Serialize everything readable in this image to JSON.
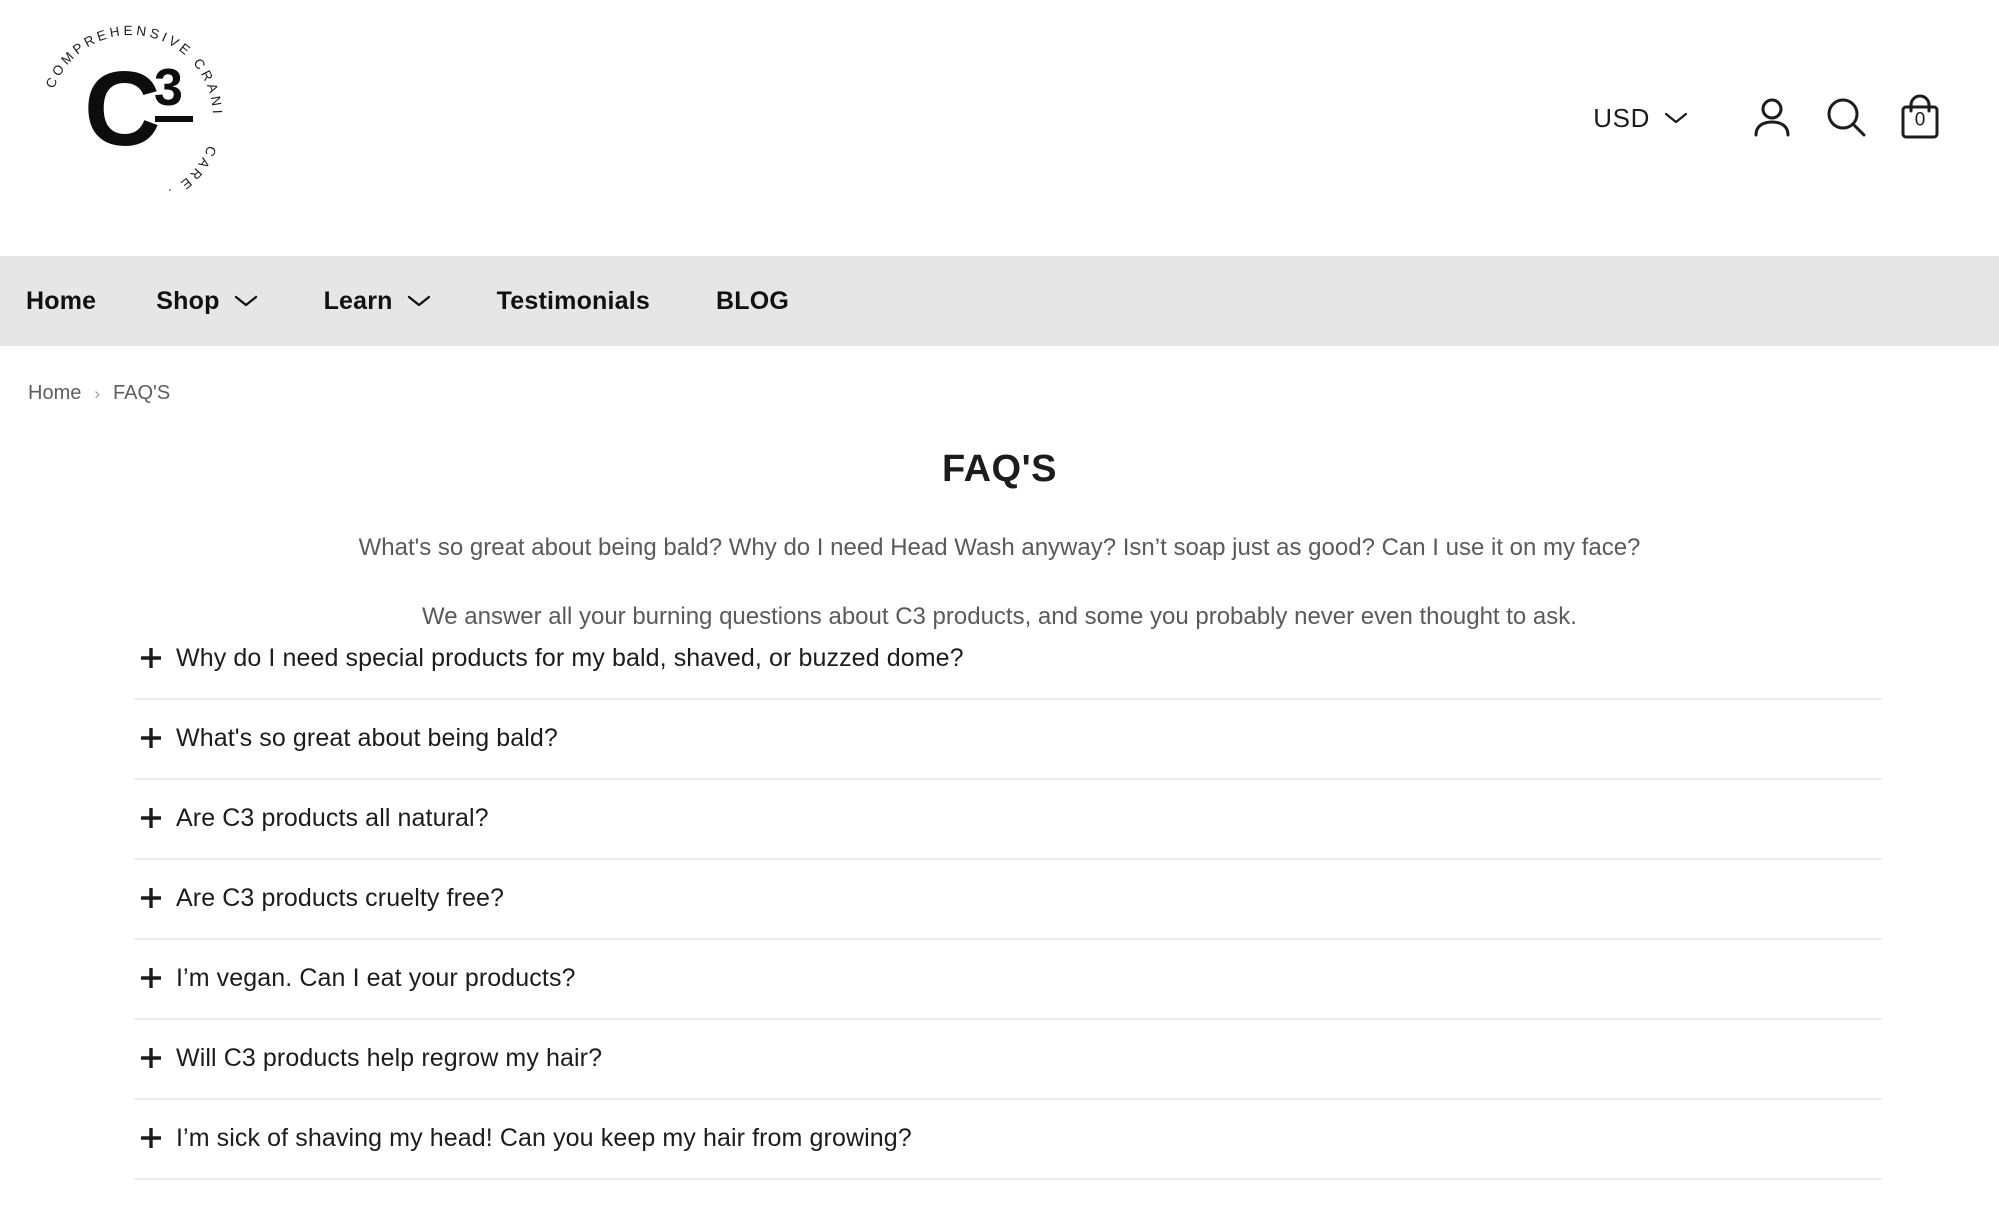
{
  "brand": {
    "logo_center": "C",
    "logo_exponent": "3",
    "logo_ring_text": "COMPREHENSIVE CRANIUM CARE ."
  },
  "header": {
    "currency": {
      "label": "USD",
      "chevron_icon": "chevron-down-icon"
    },
    "account_icon": "account-icon",
    "search_icon": "search-icon",
    "cart_icon": "shopping-bag-icon",
    "cart_count": "0"
  },
  "nav": {
    "items": [
      {
        "label": "Home",
        "has_chevron": false
      },
      {
        "label": "Shop",
        "has_chevron": true
      },
      {
        "label": "Learn",
        "has_chevron": true
      },
      {
        "label": "Testimonials",
        "has_chevron": false
      },
      {
        "label": "BLOG",
        "has_chevron": false
      }
    ]
  },
  "breadcrumb": {
    "home": "Home",
    "separator": "›",
    "current": "FAQ'S"
  },
  "main": {
    "title": "FAQ'S",
    "intro_line_1": "What's so great about being bald? Why do I need Head Wash anyway? Isn’t soap just as good? Can I use it on my face?",
    "intro_line_2": "We answer all your burning questions about C3 products, and some you probably never even thought to ask."
  },
  "faq": {
    "expand_icon": "plus-icon",
    "items": [
      {
        "question": "Why do I need special products for my bald, shaved, or buzzed dome?"
      },
      {
        "question": "What's so great about being bald?"
      },
      {
        "question": "Are C3 products all natural?"
      },
      {
        "question": "Are C3 products cruelty free?"
      },
      {
        "question": "I’m vegan. Can I eat your products?"
      },
      {
        "question": "Will C3 products help regrow my hair?"
      },
      {
        "question": "I’m sick of shaving my head! Can you keep my hair from growing?"
      }
    ]
  },
  "colors": {
    "nav_background": "#e6e6e6",
    "text_primary": "#1c1c1c",
    "text_muted": "#5a5a5a",
    "divider": "#ededed"
  }
}
